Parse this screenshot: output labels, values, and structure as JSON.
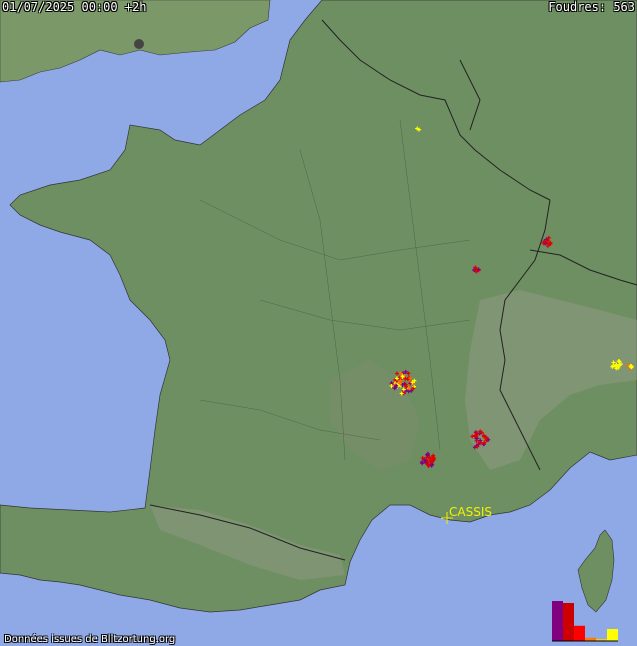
{
  "header": {
    "timestamp": "01/07/2025 00:00 +2h",
    "strike_count": "Foudres: 563"
  },
  "footer": {
    "credit": "Données issues de Blitzortung.org"
  },
  "city": {
    "name": "CASSIS"
  },
  "colors": {
    "sea": "#8fa8e6",
    "land": "#6e8f62",
    "border": "#2a2a2a",
    "recent": "#ffff00",
    "mid": "#ff6a00",
    "older": "#e00000",
    "oldest": "#800080"
  },
  "legend": {
    "age_bars": [
      {
        "color": "#800080",
        "level": 1.0
      },
      {
        "color": "#cc0000",
        "level": 0.95
      },
      {
        "color": "#ff0000",
        "level": 0.38
      },
      {
        "color": "#ff7a00",
        "level": 0.08
      },
      {
        "color": "#ffcc00",
        "level": 0.02
      },
      {
        "color": "#ffff00",
        "level": 0.3
      }
    ]
  }
}
